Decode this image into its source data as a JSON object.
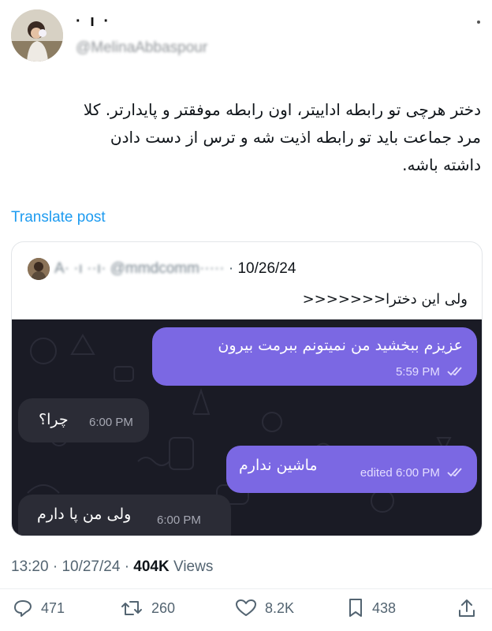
{
  "author": {
    "display_name": "· ı ·",
    "handle": "@MelinaAbbaspour"
  },
  "tweet": {
    "text": "دختر هرچی تو رابطه اداییتر، اون رابطه موفقتر و پایدارتر. کلا\nمرد جماعت باید تو رابطه اذیت شه و ترس از دست دادن\nداشته باشه.",
    "translate_label": "Translate post"
  },
  "quote": {
    "name": "A· ·ı ··ı·",
    "handle": "@mmdcomm·····",
    "separator": "·",
    "date": "10/26/24",
    "text": "ولی این دخترا<<<<<<<"
  },
  "chat": {
    "messages": [
      {
        "side": "out",
        "text": "عزیزم ببخشید من نمیتونم ببرمت بیرون",
        "time": "5:59 PM",
        "edited": ""
      },
      {
        "side": "in",
        "text": "چرا؟",
        "time": "6:00 PM",
        "edited": ""
      },
      {
        "side": "out",
        "text": "ماشین ندارم",
        "time": "6:00 PM",
        "edited": "edited"
      },
      {
        "side": "in",
        "text": "ولی من پا دارم",
        "time": "6:00 PM",
        "edited": ""
      }
    ]
  },
  "meta": {
    "time": "13:20",
    "date": "10/27/24",
    "views_count": "404K",
    "views_label": "Views"
  },
  "actions": {
    "replies": "471",
    "reposts": "260",
    "likes": "8.2K",
    "bookmarks": "438"
  },
  "colors": {
    "accent": "#1d9bf0",
    "outgoing_bubble": "#7b68e3",
    "incoming_bubble": "#2b2c36",
    "chat_background": "#1a1b25"
  }
}
